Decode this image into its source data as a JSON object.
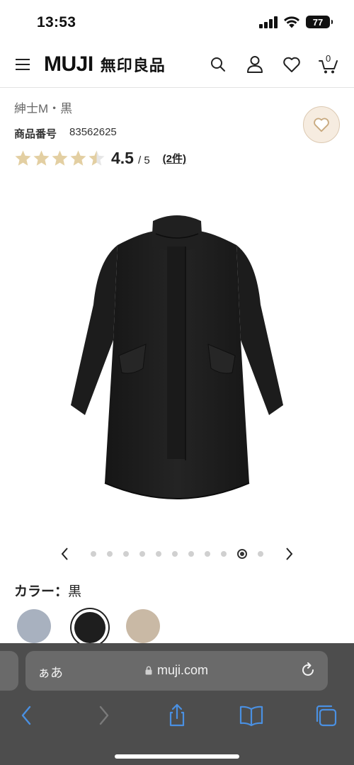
{
  "status_bar": {
    "time": "13:53",
    "battery": "77",
    "icons": [
      "signal-icon",
      "wifi-icon",
      "battery-icon"
    ]
  },
  "header": {
    "logo_latin": "MUJI",
    "logo_jp": "無印良品",
    "icons": [
      "menu-icon",
      "search-icon",
      "account-icon",
      "heart-icon",
      "cart-icon"
    ],
    "cart_count": "0"
  },
  "product": {
    "category": "紳士M・黒",
    "number_label": "商品番号",
    "number": "83562625",
    "rating": 4.5,
    "rating_value": "4.5",
    "rating_max": "/ 5",
    "review_count": "(2件)",
    "star_color": "#e3cfa2"
  },
  "carousel": {
    "total_images": 11,
    "active_index": 9
  },
  "color": {
    "label": "カラー：",
    "value": "黒",
    "swatches": [
      {
        "name": "blue-gray",
        "color": "#a8b1bf"
      },
      {
        "name": "black",
        "color": "#1e1e1e",
        "selected": true
      },
      {
        "name": "beige",
        "color": "#c9b9a5"
      }
    ]
  },
  "browser": {
    "aa_label": "ぁあ",
    "url": "muji.com",
    "toolbar_icons": [
      "back-icon",
      "forward-icon",
      "share-icon",
      "bookmarks-icon",
      "tabs-icon"
    ],
    "background": "#4d4d4d"
  }
}
